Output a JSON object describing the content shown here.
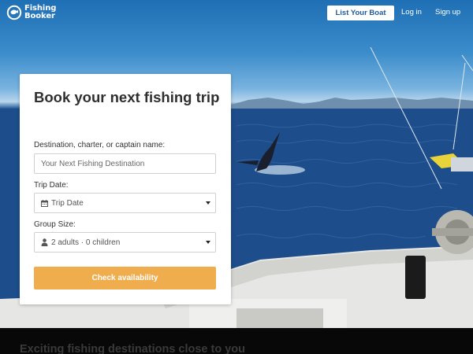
{
  "brand": {
    "name_line1": "Fishing",
    "name_line2": "Booker"
  },
  "nav": {
    "list_boat": "List Your Boat",
    "login": "Log in",
    "signup": "Sign up"
  },
  "booking": {
    "title": "Book your next fishing trip",
    "destination_label": "Destination, charter, or captain name:",
    "destination_placeholder": "Your Next Fishing Destination",
    "date_label": "Trip Date:",
    "date_value": "Trip Date",
    "group_label": "Group Size:",
    "group_value": "2 adults · 0 children",
    "submit": "Check availability"
  },
  "section": {
    "heading": "Exciting fishing destinations close to you"
  },
  "icons": {
    "logo": "fish-hook-logo-icon",
    "calendar": "calendar-icon",
    "person": "person-icon",
    "dropdown": "chevron-down-icon"
  },
  "colors": {
    "accent": "#f0ad4e",
    "brand_blue": "#1f5a9a",
    "card": "#ffffff"
  }
}
